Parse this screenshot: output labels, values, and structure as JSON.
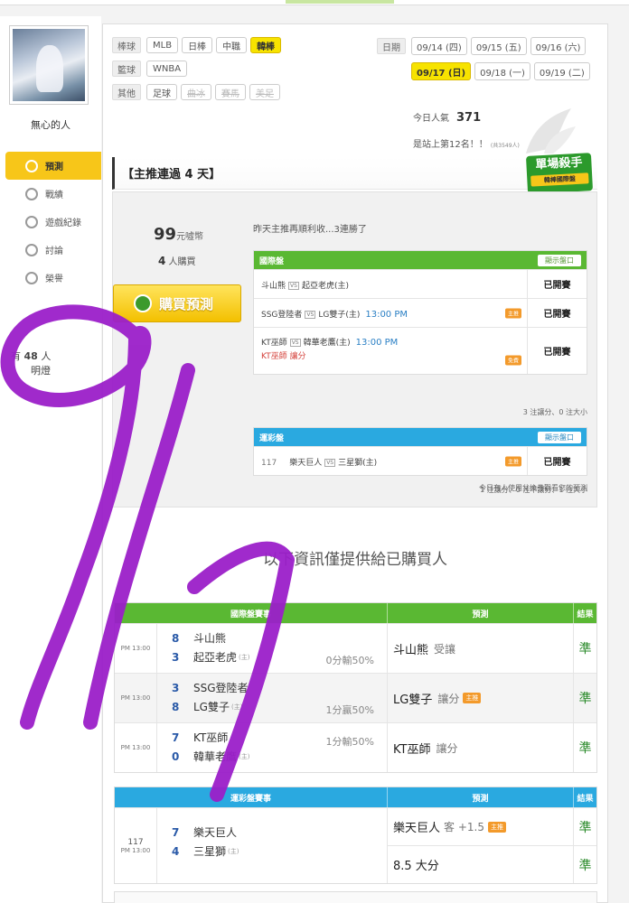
{
  "user": {
    "name": "無心的人"
  },
  "sidebar": {
    "items": [
      {
        "label": "預測",
        "icon": "target-icon",
        "active": true
      },
      {
        "label": "戰績",
        "icon": "chat-icon"
      },
      {
        "label": "遊戲紀錄",
        "icon": "circle-icon"
      },
      {
        "label": "討論",
        "icon": "search-icon"
      },
      {
        "label": "榮譽",
        "icon": "medal-icon"
      }
    ],
    "note_prefix": "有",
    "note_value": "48",
    "note_suffix": "人",
    "note_line2": "明燈"
  },
  "filters": {
    "rows": [
      {
        "label": "棒球",
        "chips": [
          {
            "t": "MLB"
          },
          {
            "t": "日棒"
          },
          {
            "t": "中職"
          },
          {
            "t": "韓棒",
            "sel": true
          }
        ]
      },
      {
        "label": "籃球",
        "chips": [
          {
            "t": "WNBA"
          }
        ]
      },
      {
        "label": "其他",
        "chips": [
          {
            "t": "足球"
          },
          {
            "t": "曲冰",
            "off": true
          },
          {
            "t": "賽馬",
            "off": true
          },
          {
            "t": "美足",
            "off": true
          }
        ]
      }
    ]
  },
  "dates": {
    "label": "日期",
    "row1": [
      "09/14 (四)",
      "09/15 (五)",
      "09/16 (六)"
    ],
    "row2": [
      "09/17 (日)",
      "09/18 (一)",
      "09/19 (二)"
    ],
    "selected": "09/17 (日)"
  },
  "stats": {
    "popularity_label": "今日人氣",
    "popularity": "371",
    "rank_text": "是站上第12名！！",
    "rank_small": "(共3549人)"
  },
  "streak": {
    "title": "【主推連過 4 天】",
    "badge_line1": "單場殺手",
    "badge_line2": "韓棒國際盤"
  },
  "offer": {
    "price": "99",
    "price_unit": "元噓幣",
    "buyers": "4",
    "buyers_unit": "人購買",
    "buy_label": "購買預測",
    "recap": "昨天主推再順利收...3連勝了"
  },
  "intl_table": {
    "title": "國際盤",
    "show_label": "顯示盤口",
    "rows": [
      {
        "home": "斗山熊",
        "away": "起亞老虎(主)",
        "time": "",
        "note": "",
        "tag": "",
        "result": "已開賽"
      },
      {
        "home": "SSG登陸者",
        "away": "LG雙子(主)",
        "time": "13:00 PM",
        "note": "",
        "tag": "主推",
        "result": "已開賽"
      },
      {
        "home": "KT巫師",
        "away": "韓華老鷹(主)",
        "time": "13:00 PM",
        "note": "KT巫師  讓分",
        "tag": "免費",
        "result": "已開賽"
      }
    ],
    "summary": "3 注讓分、0 注大小"
  },
  "lottery_table": {
    "title": "運彩盤",
    "show_label": "顯示盤口",
    "rows": [
      {
        "num": "117",
        "home": "樂天巨人",
        "away": "三星獅(主)",
        "tag": "主推",
        "result": "已開賽"
      }
    ],
    "summary": "1 注讓分、0 注不讓分、1 注大小",
    "voucher_note": "今日有人使用兌換券觀看您的預測"
  },
  "locked_message": "以下資訊僅提供給已購買人",
  "results_intl": {
    "head_game": "國際盤賽事",
    "head_pred": "預測",
    "head_result": "結果",
    "rows": [
      {
        "time": "PM 13:00",
        "s1": "8",
        "t1": "斗山熊",
        "s2": "3",
        "t2": "起亞老虎",
        "host": "(主)",
        "odds": "0分輸50%",
        "pred": "斗山熊",
        "pred_sub": "受讓",
        "tag": "",
        "result": "準"
      },
      {
        "time": "PM 13:00",
        "s1": "3",
        "t1": "SSG登陸者",
        "s2": "8",
        "t2": "LG雙子",
        "host": "(主)",
        "odds": "1分贏50%",
        "pred": "LG雙子",
        "pred_sub": "讓分",
        "tag": "主推",
        "result": "準"
      },
      {
        "time": "PM 13:00",
        "s1": "7",
        "t1": "KT巫師",
        "s2": "0",
        "t2": "韓華老鷹",
        "host": "(主)",
        "odds": "1分輸50%",
        "pred": "KT巫師",
        "pred_sub": "讓分",
        "tag": "",
        "result": "準"
      }
    ]
  },
  "results_lottery": {
    "head_game": "運彩盤賽事",
    "head_pred": "預測",
    "head_result": "結果",
    "num": "117",
    "time": "PM 13:00",
    "s1": "7",
    "t1": "樂天巨人",
    "s2": "4",
    "t2": "三星獅",
    "host": "(主)",
    "pred1": "樂天巨人",
    "pred1_sub": "客 +1.5",
    "pred1_tag": "主推",
    "result1": "準",
    "pred2": "8.5 大分",
    "result2": "準"
  },
  "colors": {
    "accent": "#f7c619",
    "green": "#5ab833",
    "blue": "#2aa9e0",
    "scribble": "#9b1fc9"
  }
}
